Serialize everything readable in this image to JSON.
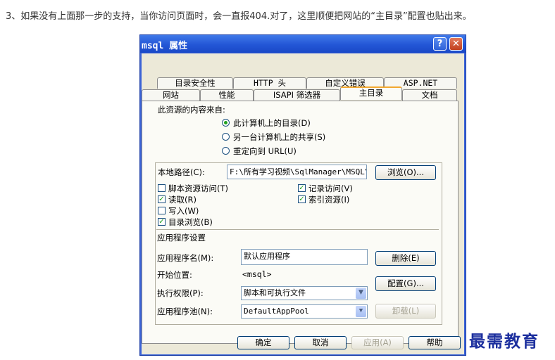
{
  "caption": "3、如果没有上面那一步的支持，当你访问页面时，会一直报404.对了，这里顺便把网站的“主目录”配置也贴出来。",
  "dialog": {
    "title": "msql 属性",
    "help": "?",
    "close": "✕"
  },
  "tabs_row1": [
    "目录安全性",
    "HTTP 头",
    "自定义错误",
    "ASP.NET"
  ],
  "tabs_row2": [
    "网站",
    "性能",
    "ISAPI 筛选器",
    "主目录",
    "文档"
  ],
  "active_tab": "主目录",
  "content_source": {
    "heading": "此资源的内容来自:",
    "options": [
      "此计算机上的目录(D)",
      "另一台计算机上的共享(S)",
      "重定向到 URL(U)"
    ],
    "selected": "此计算机上的目录(D)"
  },
  "local_path": {
    "label": "本地路径(C):",
    "value": "F:\\所有学习视频\\SqlManager\\MSQL\\M",
    "browse": "浏览(O)..."
  },
  "permissions": {
    "script_source": {
      "label": "脚本资源访问(T)",
      "checked": false
    },
    "read": {
      "label": "读取(R)",
      "checked": true
    },
    "write": {
      "label": "写入(W)",
      "checked": false
    },
    "dir_browse": {
      "label": "目录浏览(B)",
      "checked": true
    },
    "log_visits": {
      "label": "记录访问(V)",
      "checked": true
    },
    "index_resource": {
      "label": "索引资源(I)",
      "checked": true
    }
  },
  "app_settings": {
    "heading": "应用程序设置",
    "app_name_label": "应用程序名(M):",
    "app_name_value": "默认应用程序",
    "remove": "删除(E)",
    "start_label": "开始位置:",
    "start_value": "<msql>",
    "config": "配置(G)...",
    "exec_label": "执行权限(P):",
    "exec_value": "脚本和可执行文件",
    "pool_label": "应用程序池(N):",
    "pool_value": "DefaultAppPool",
    "unload": "卸载(L)"
  },
  "footer": {
    "ok": "确定",
    "cancel": "取消",
    "apply": "应用(A)",
    "help": "帮助"
  },
  "watermark": "最需教育"
}
